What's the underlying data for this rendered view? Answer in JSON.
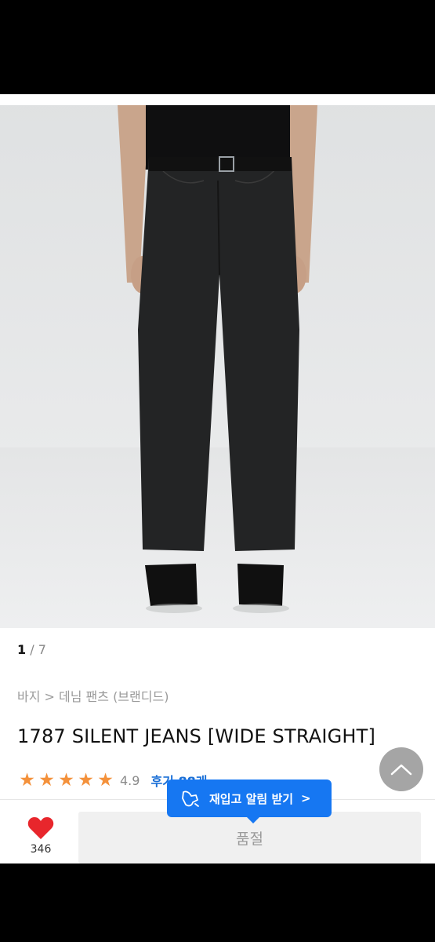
{
  "gallery": {
    "current": "1",
    "total": "/ 7",
    "image": "product-photo-jeans"
  },
  "breadcrumb": "바지 > 데님 팬츠 (브랜디드)",
  "product": {
    "title": "1787 SILENT JEANS [WIDE STRAIGHT]",
    "rating_stars": 5,
    "rating_value": "4.9",
    "reviews_label": "후기 88개"
  },
  "restock": {
    "label": "재입고 알림 받기",
    "chevron": ">"
  },
  "like": {
    "count": "346"
  },
  "purchase": {
    "status_label": "품절"
  },
  "colors": {
    "accent": "#1677f2",
    "star": "#f4913b",
    "heart": "#e8262c",
    "soldout_bg": "#f0f0f0"
  },
  "icons": {
    "restock": "bell-icon",
    "like": "heart-icon",
    "scroll_top": "chevron-up-icon"
  }
}
